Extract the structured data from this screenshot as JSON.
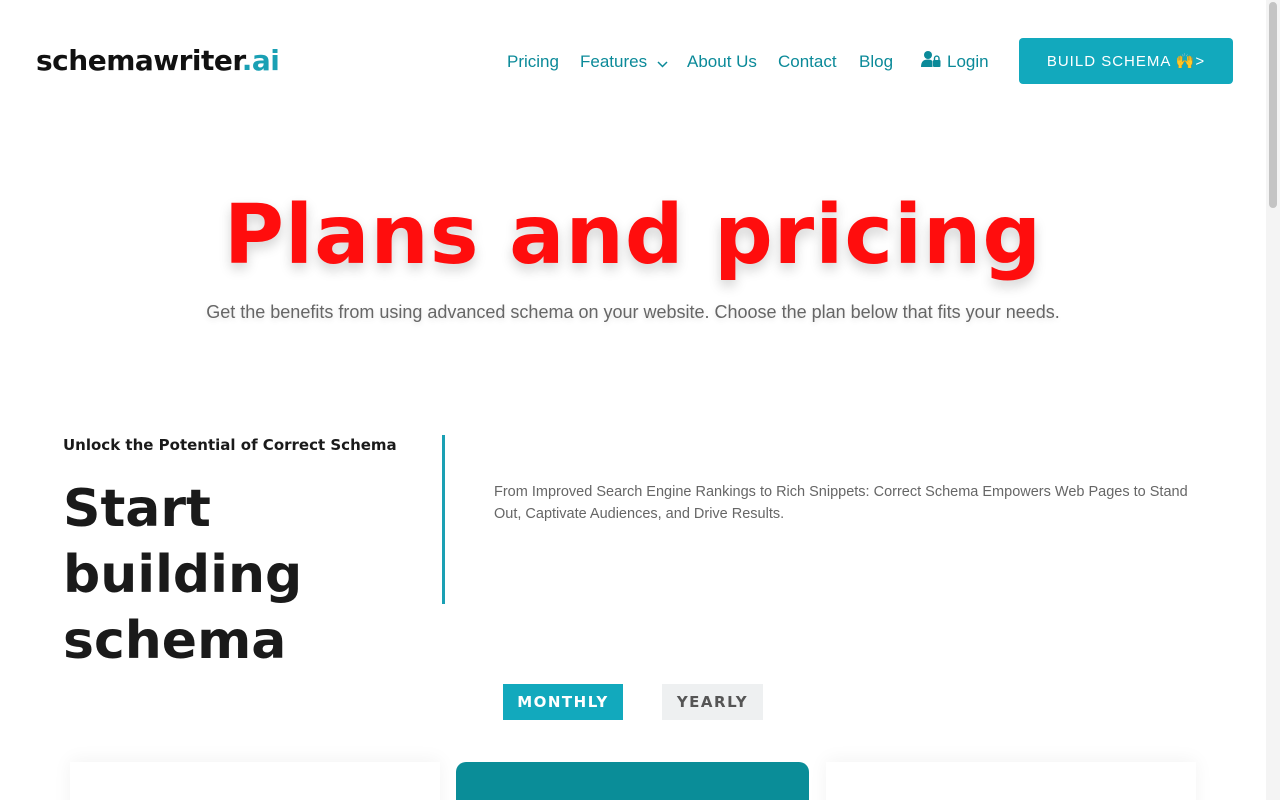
{
  "header": {
    "logo": {
      "name": "schemawriter",
      "tld": ".ai"
    },
    "nav": [
      {
        "label": "Pricing"
      },
      {
        "label": "Features"
      },
      {
        "label": "About Us"
      },
      {
        "label": "Contact"
      },
      {
        "label": "Blog"
      },
      {
        "label": "Login"
      }
    ],
    "cta_label": "BUILD SCHEMA 🙌>"
  },
  "hero": {
    "title": "Plans and pricing",
    "subtitle": "Get the benefits from using advanced schema on your website. Choose the plan below that fits your needs."
  },
  "intro": {
    "eyebrow": "Unlock the Potential of Correct Schema",
    "title": "Start building schema",
    "description": "From Improved Search Engine Rankings to Rich Snippets: Correct Schema Empowers Web Pages to Stand Out, Captivate Audiences, and Drive Results."
  },
  "billing_toggle": {
    "monthly": "MONTHLY",
    "yearly": "YEARLY",
    "selected": "MONTHLY"
  },
  "icons": {
    "features_dropdown": "chevron-down-icon",
    "login": "user-lock-icon"
  },
  "colors": {
    "accent": "#12a9bd",
    "nav_link": "#0b8a99",
    "hero_title": "#ff0d0d",
    "featured_card": "#0a8d98"
  }
}
